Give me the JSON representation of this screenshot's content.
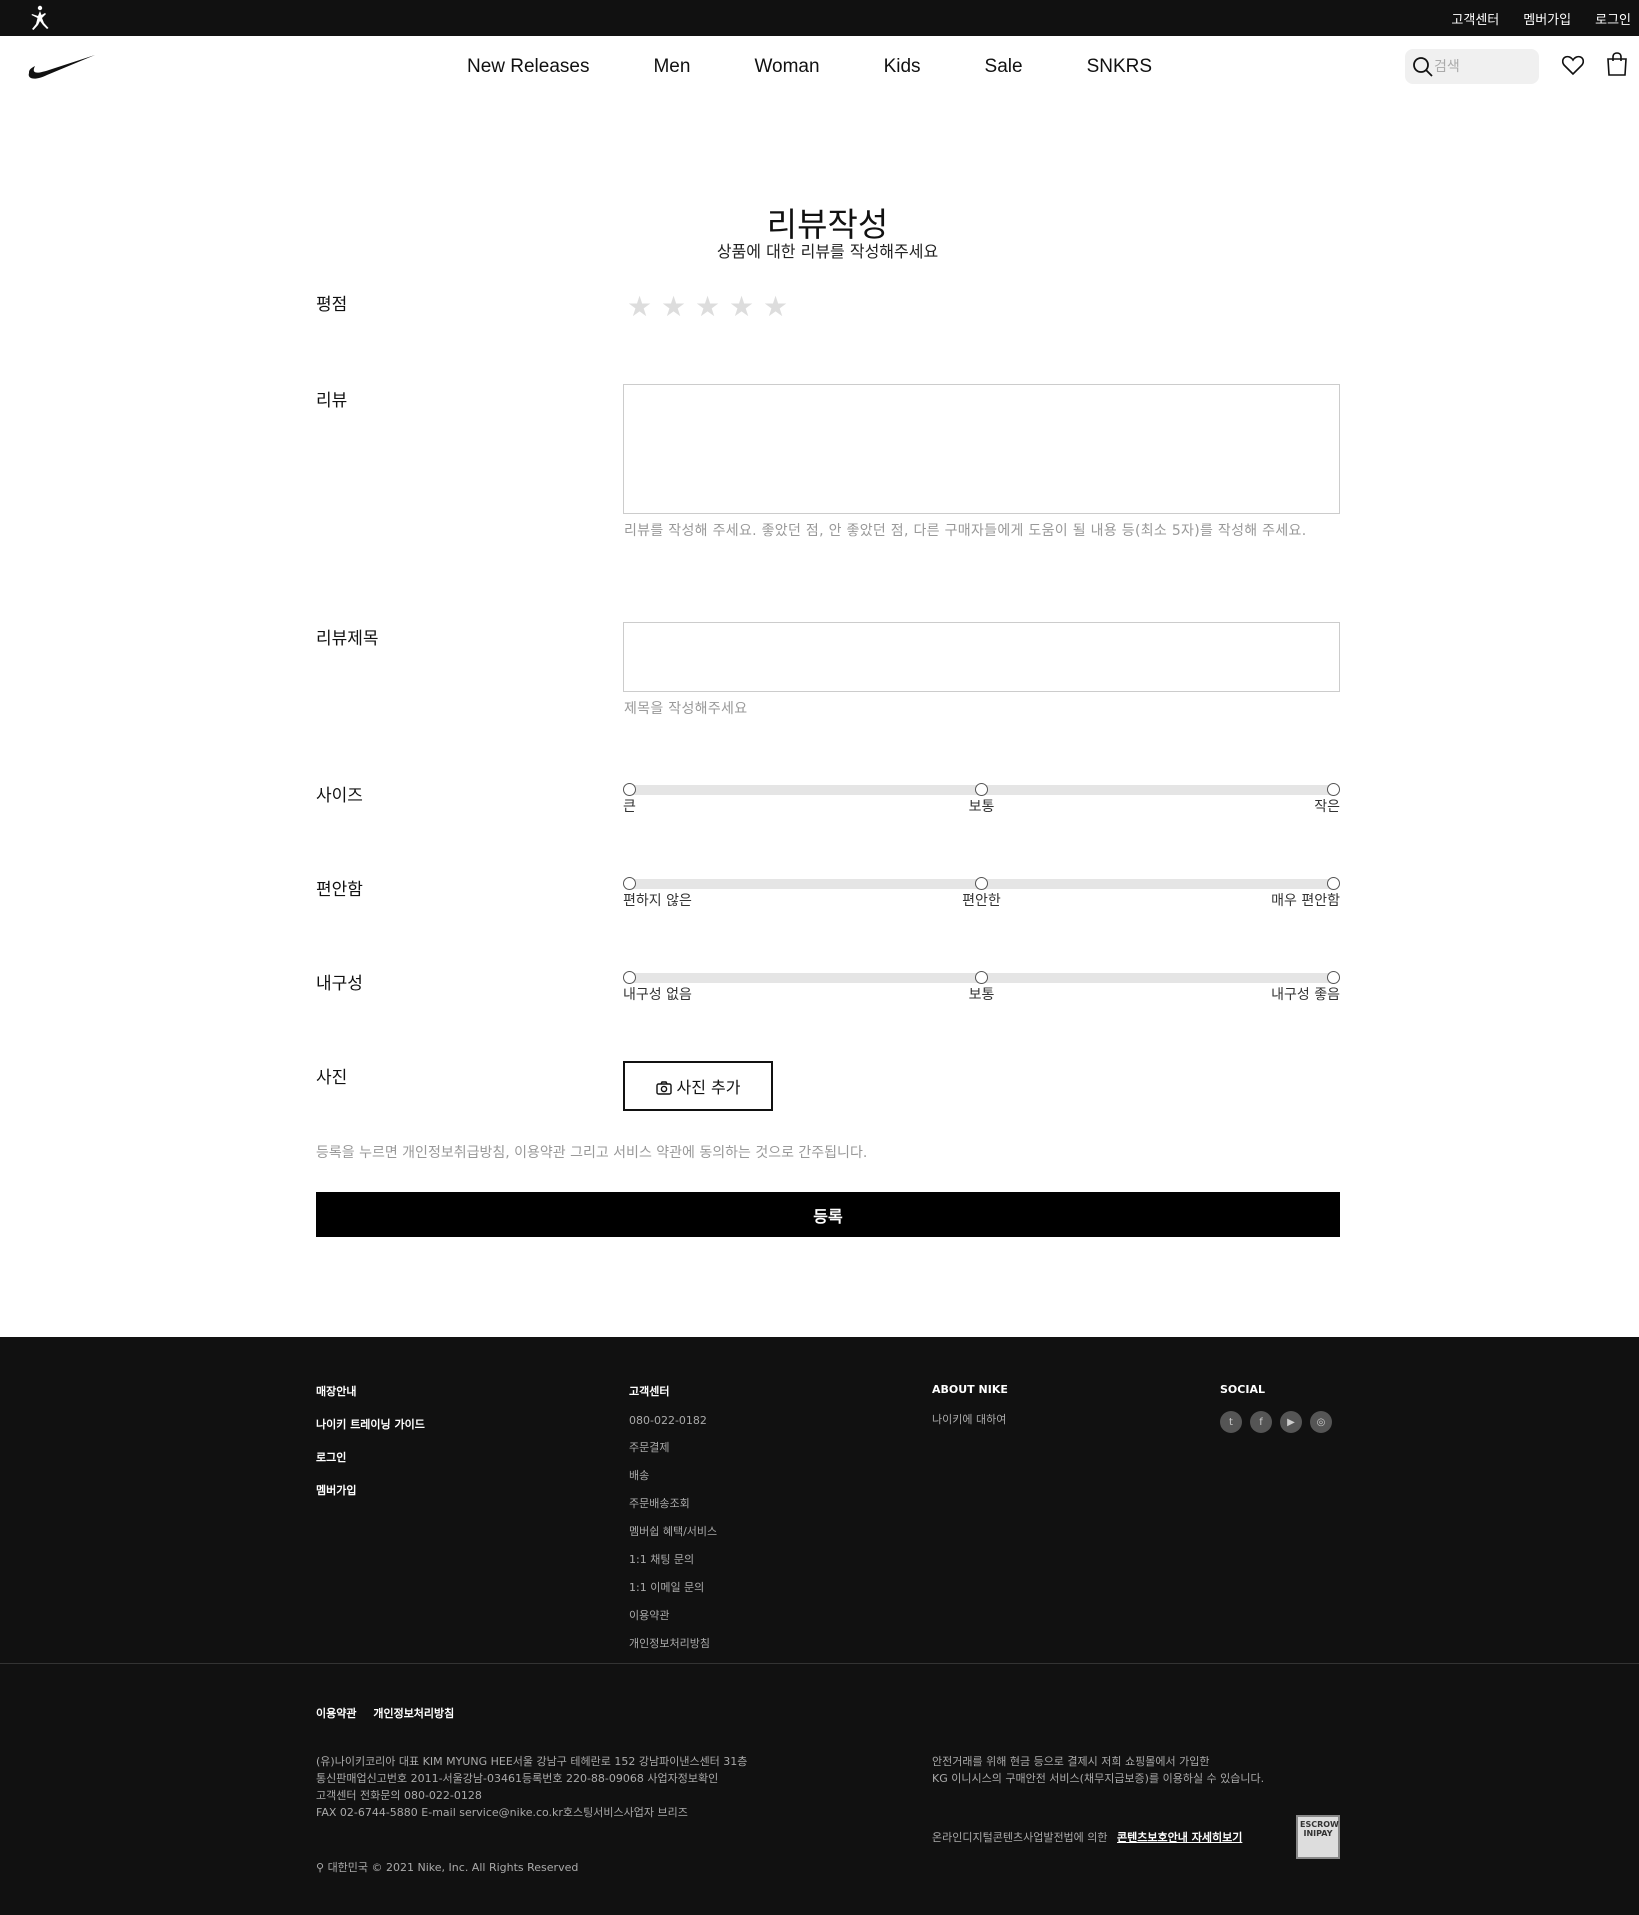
{
  "topbar": {
    "links": [
      "고객센터",
      "멤버가입",
      "로그인"
    ]
  },
  "nav": {
    "menu": [
      "New Releases",
      "Men",
      "Woman",
      "Kids",
      "Sale",
      "SNKRS"
    ],
    "search_placeholder": "검색"
  },
  "form": {
    "title": "리뷰작성",
    "subtitle": "상품에 대한 리뷰를 작성해주세요",
    "rating_label": "평점",
    "rating_stars": "★",
    "rating_value": 0,
    "rating_max": 5,
    "review_label": "리뷰",
    "review_hint": "리뷰를 작성해 주세요. 좋았던 점, 안 좋았던 점, 다른 구매자들에게 도움이 될 내용 등(최소 5자)를 작성해 주세요.",
    "review_title_label": "리뷰제목",
    "review_title_hint": "제목을 작성해주세요",
    "size": {
      "label": "사이즈",
      "left": "큰",
      "mid": "보통",
      "right": "작은"
    },
    "comfort": {
      "label": "편안함",
      "left": "편하지 않은",
      "mid": "편안한",
      "right": "매우 편안함"
    },
    "durability": {
      "label": "내구성",
      "left": "내구성 없음",
      "mid": "보통",
      "right": "내구성 좋음"
    },
    "photo_label": "사진",
    "photo_button": "사진 추가",
    "agree_text": "등록을 누르면 개인정보취급방침, 이용약관 그리고 서비스 약관에 동의하는 것으로 간주됩니다.",
    "submit": "등록"
  },
  "footer": {
    "col1": [
      "매장안내",
      "나이키 트레이닝 가이드",
      "로그인",
      "멤버가입"
    ],
    "col2_title": "고객센터",
    "col2": [
      "080-022-0182",
      "주문결제",
      "배송",
      "주문배송조회",
      "멤버쉽 혜택/서비스",
      "1:1 채팅 문의",
      "1:1 이메일 문의",
      "이용약관",
      "개인정보처리방침"
    ],
    "col3_title": "ABOUT NIKE",
    "col3": [
      "나이키에 대하여"
    ],
    "col4_title": "SOCIAL",
    "social": [
      "t",
      "f",
      "▶",
      "◎"
    ],
    "bottom_links": [
      "이용약관",
      "개인정보처리방침"
    ],
    "info": [
      "(유)나이키코리아 대표 KIM MYUNG HEE서울 강남구 테헤란로 152 강남파이낸스센터 31층",
      "통신판매업신고번호 2011-서울강남-03461등록번호 220-88-09068 사업자정보확인",
      "고객센터 전화문의 080-022-0128",
      "FAX 02-6744-5880 E-mail service@nike.co.kr호스팅서비스사업자 브리즈"
    ],
    "escrow_lines": [
      "안전거래를 위해 현금 등으로 결제시 저희 쇼핑몰에서 가입한",
      "KG 이니시스의 구매안전 서비스(채무지급보증)를 이용하실 수 있습니다."
    ],
    "contents_text": "온라인디지털콘텐츠사업발전법에 의한",
    "contents_link": "콘텐츠보호안내 자세히보기",
    "escrow_badge": "ESCROW INIPAY",
    "copyright": "대한민국 © 2021 Nike, Inc. All Rights Reserved"
  }
}
